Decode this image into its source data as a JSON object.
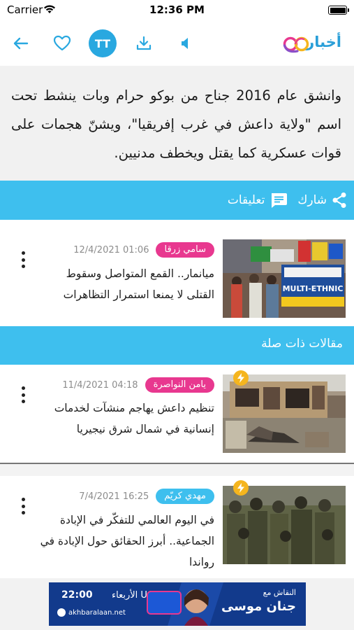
{
  "status_bar": {
    "carrier": "Carrier",
    "time": "12:36 PM"
  },
  "toolbar": {
    "font_size_label": "TT",
    "logo_text": "أخبار الآن",
    "icons": [
      "back-arrow-icon",
      "heart-icon",
      "font-size-icon",
      "download-icon",
      "speaker-icon"
    ]
  },
  "article": {
    "body": "وانشق عام 2016 جناح من بوكو حرام وبات ينشط تحت اسم \"ولاية داعش في غرب إفريقيا\"، ويشنّ هجمات على قوات عسكرية كما يقتل ويخطف مدنيين."
  },
  "share_bar": {
    "share_label": "شارك",
    "comments_label": "تعليقات"
  },
  "featured_card": {
    "author": "سامي زرقا",
    "date": "12/4/2021 01:06",
    "title": "ميانمار.. القمع المتواصل وسقوط القتلى لا يمنعا استمرار التظاهرات",
    "image_sign_text": "MULTI-ETHNIC"
  },
  "related_section": {
    "title": "مقالات ذات صلة",
    "items": [
      {
        "author": "يامن النواصرة",
        "date": "11/4/2021 04:18",
        "title": "تنظيم داعش يهاجم منشآت لخدمات إنسانية في شمال شرق نيجيريا",
        "badge_color": "#e8388f"
      },
      {
        "author": "مهدي كريّم",
        "date": "7/4/2021 16:25",
        "title": "في اليوم العالمي للتفكّر في الإبادة الجماعية.. أبرز الحقائق حول الإبادة في رواندا",
        "badge_color": "#3ebfee"
      }
    ]
  },
  "ad": {
    "host_label": "النقاش مع",
    "host_name": "جنان موسى",
    "day": "الأربعاء UAE",
    "time": "22:00",
    "url": "akhbaralaan.net"
  },
  "colors": {
    "accent_blue": "#3ebfee",
    "badge_pink": "#e8388f",
    "bolt_yellow": "#f5b51e"
  }
}
